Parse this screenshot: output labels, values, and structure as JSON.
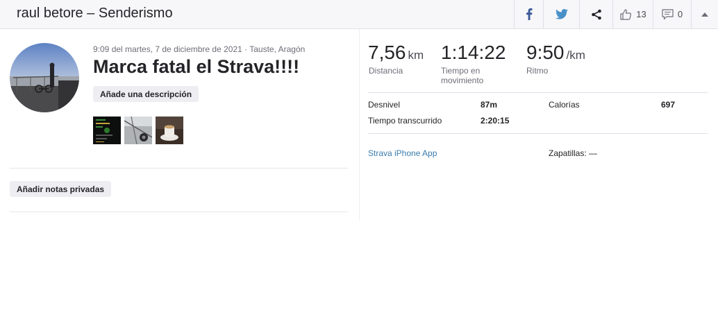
{
  "header": {
    "title": "raul betore – Senderismo",
    "kudos_count": "13",
    "comment_count": "0"
  },
  "activity": {
    "meta": "9:09 del martes, 7 de diciembre de 2021 · Tauste, Aragón",
    "title": "Marca fatal el Strava!!!!",
    "add_description": "Añade una descripción",
    "private_notes": "Añadir notas privadas"
  },
  "stats": {
    "distance": {
      "value": "7,56",
      "unit": "km",
      "label": "Distancia"
    },
    "moving_time": {
      "value": "1:14:22",
      "label": "Tiempo en movimiento"
    },
    "pace": {
      "value": "9:50",
      "unit": "/km",
      "label": "Ritmo"
    }
  },
  "details": {
    "elevation_label": "Desnivel",
    "elevation_value": "87m",
    "calories_label": "Calorías",
    "calories_value": "697",
    "elapsed_label": "Tiempo transcurrido",
    "elapsed_value": "2:20:15"
  },
  "device": {
    "app": "Strava iPhone App",
    "shoes": "Zapatillas: —"
  },
  "colors": {
    "facebook": "#3b5998",
    "twitter": "#4a90c8",
    "link": "#3a7bab"
  }
}
